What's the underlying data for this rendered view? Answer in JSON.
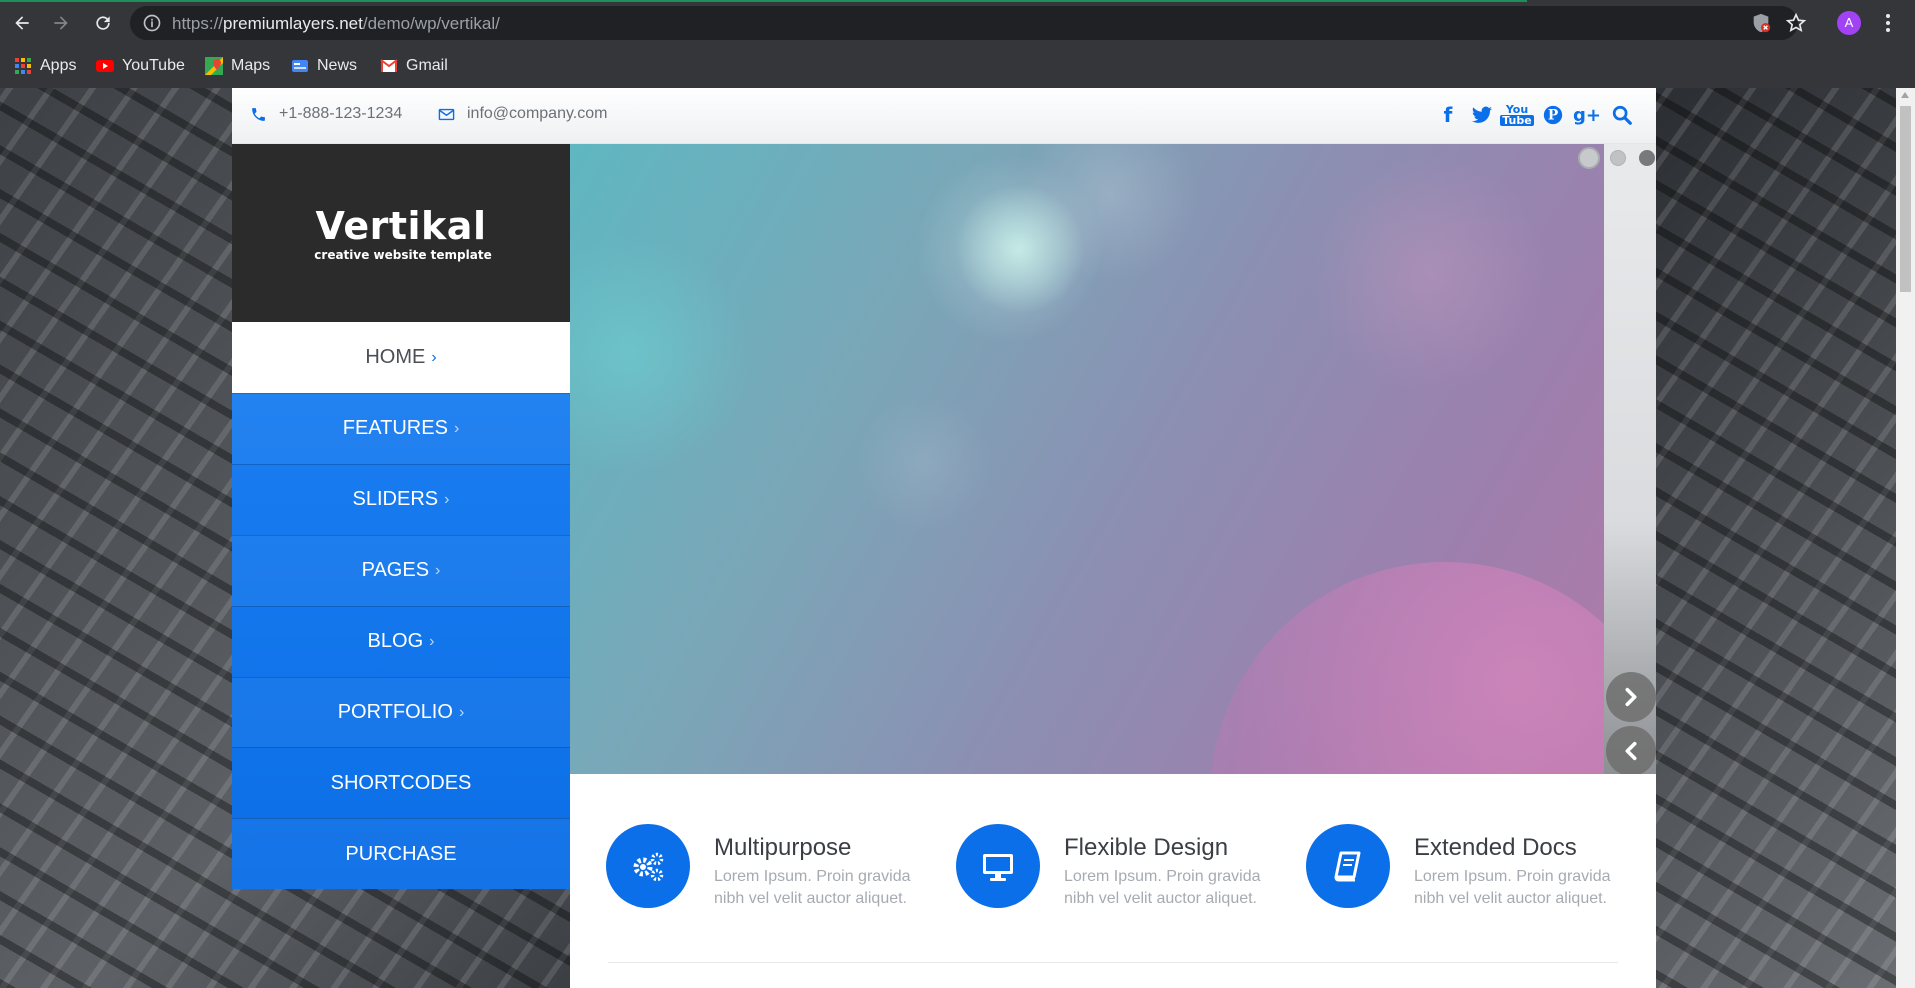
{
  "browser": {
    "url_prefix": "https://",
    "url_domain": "premiumlayers.net",
    "url_path": "/demo/wp/vertikal/",
    "profile_initial": "A",
    "bookmarks": [
      {
        "label": "Apps",
        "icon": "apps-grid-icon"
      },
      {
        "label": "YouTube",
        "icon": "youtube-icon"
      },
      {
        "label": "Maps",
        "icon": "maps-icon"
      },
      {
        "label": "News",
        "icon": "news-icon"
      },
      {
        "label": "Gmail",
        "icon": "gmail-icon"
      }
    ]
  },
  "topbar": {
    "phone": "+1-888-123-1234",
    "email": "info@company.com",
    "social": [
      "facebook",
      "twitter",
      "youtube",
      "pinterest",
      "google-plus",
      "search"
    ]
  },
  "logo": {
    "title": "Vertikal",
    "subtitle": "creative website template"
  },
  "menu": {
    "home": "HOME",
    "items": [
      "FEATURES",
      "SLIDERS",
      "PAGES",
      "BLOG",
      "PORTFOLIO",
      "SHORTCODES",
      "PURCHASE"
    ],
    "has_arrow": [
      true,
      true,
      true,
      true,
      true,
      false,
      false
    ]
  },
  "features": [
    {
      "title": "Multipurpose",
      "text": "Lorem Ipsum. Proin gravida nibh vel velit auctor aliquet.",
      "icon": "gears-icon"
    },
    {
      "title": "Flexible Design",
      "text": "Lorem Ipsum. Proin gravida nibh vel velit auctor aliquet.",
      "icon": "monitor-icon"
    },
    {
      "title": "Extended Docs",
      "text": "Lorem Ipsum. Proin gravida nibh vel velit auctor aliquet.",
      "icon": "book-icon"
    }
  ],
  "colors": {
    "accent": "#0a6fe8",
    "browser_bg": "#35363a",
    "logo_bg": "#2b2b2c"
  }
}
